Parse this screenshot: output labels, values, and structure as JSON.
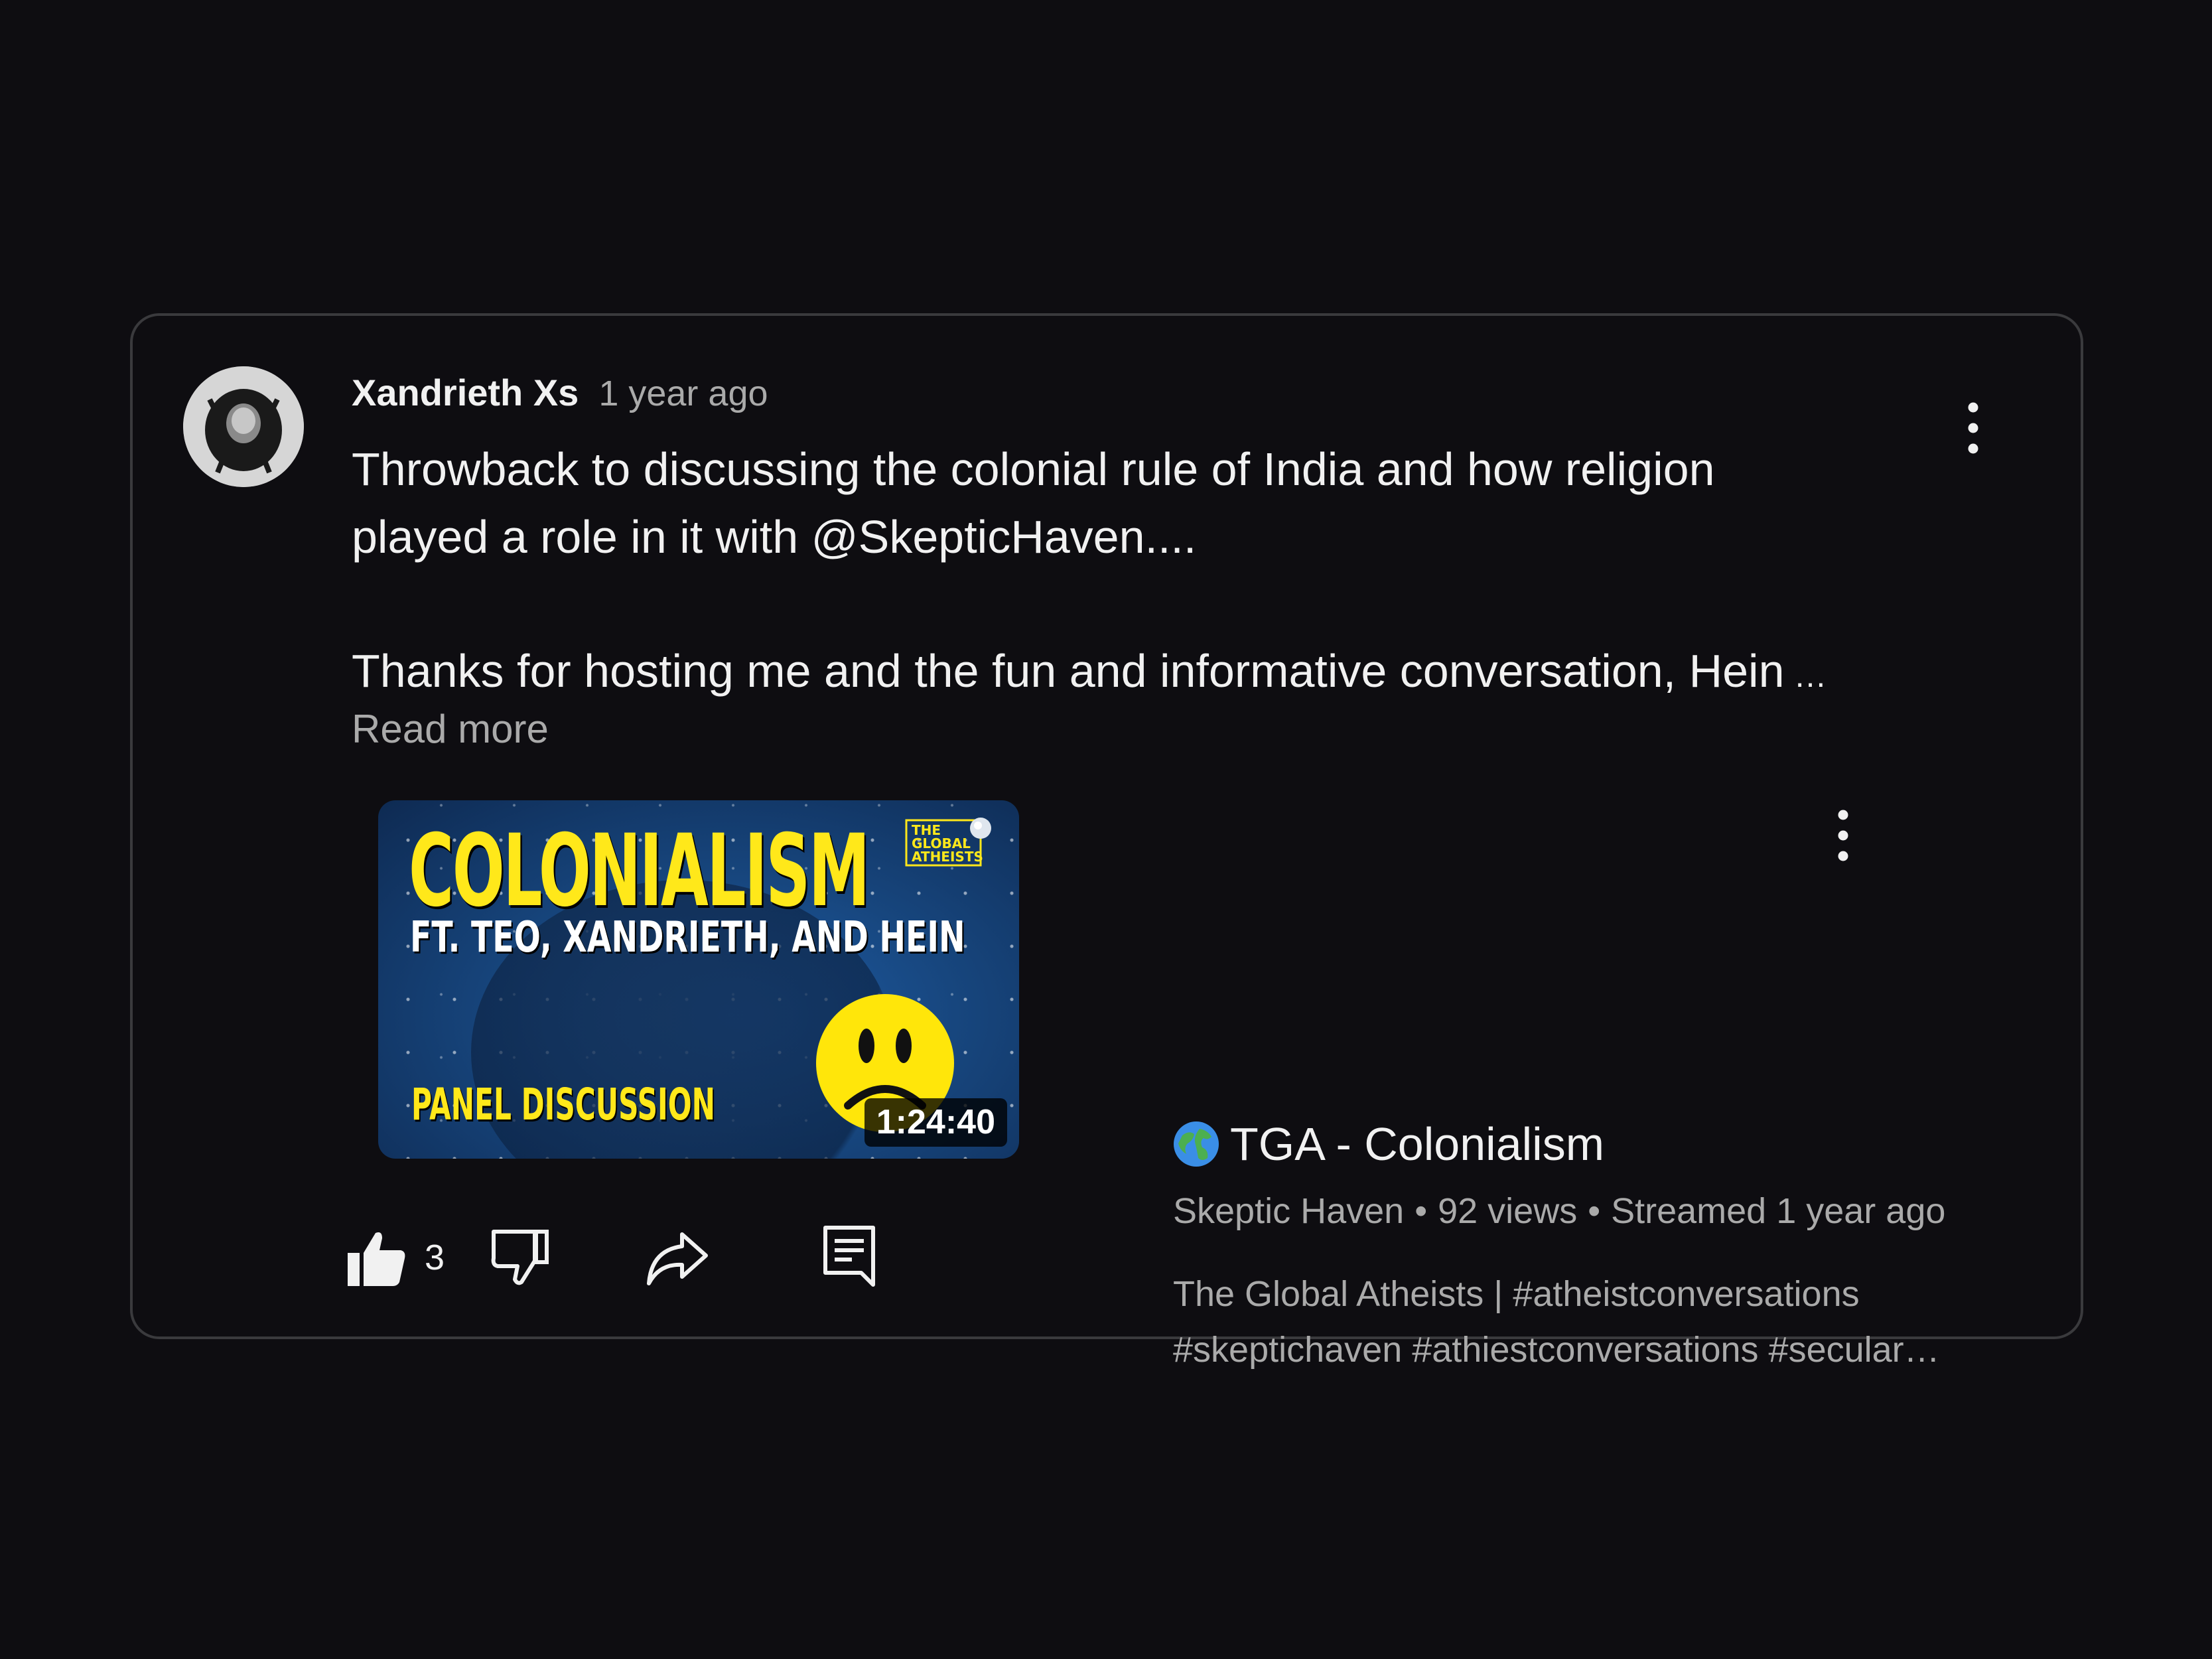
{
  "comment": {
    "author": "Xandrieth Xs",
    "timestamp": "1 year ago",
    "text_line1": "Throwback to discussing the colonial rule of India and how religion",
    "text_line2": "played a role in it with @SkepticHaven....",
    "text_line3": "Thanks for hosting me and the fun and informative conversation, Hein",
    "ellipsis": "…",
    "read_more": "Read more",
    "like_count": "3"
  },
  "video": {
    "title": "TGA - Colonialism",
    "channel": "Skeptic Haven",
    "views": "92 views",
    "streamed": "Streamed 1 year ago",
    "separator": "•",
    "description_line1": "The Global Atheists | #atheistconversations",
    "description_line2": "#skeptichaven #athiestconversations #secular…",
    "duration": "1:24:40",
    "thumbnail": {
      "title": "COLONIALISM",
      "subtitle": "FT. TEO, XANDRIETH, AND HEIN",
      "panel": "PANEL DISCUSSION",
      "logo_text": [
        "THE",
        "GLOBAL",
        "ATHEISTS"
      ]
    }
  },
  "icons": {
    "more": "more-vert-icon",
    "like": "thumbs-up-icon",
    "dislike": "thumbs-down-icon",
    "share": "share-icon",
    "reply": "comment-reply-icon",
    "globe": "globe-emoji-icon"
  },
  "colors": {
    "background": "#0e0d11",
    "card_border": "#3a3a3d",
    "primary_text": "#f1f1f1",
    "secondary_text": "#aaaaaa",
    "thumb_yellow": "#ffe81a"
  }
}
